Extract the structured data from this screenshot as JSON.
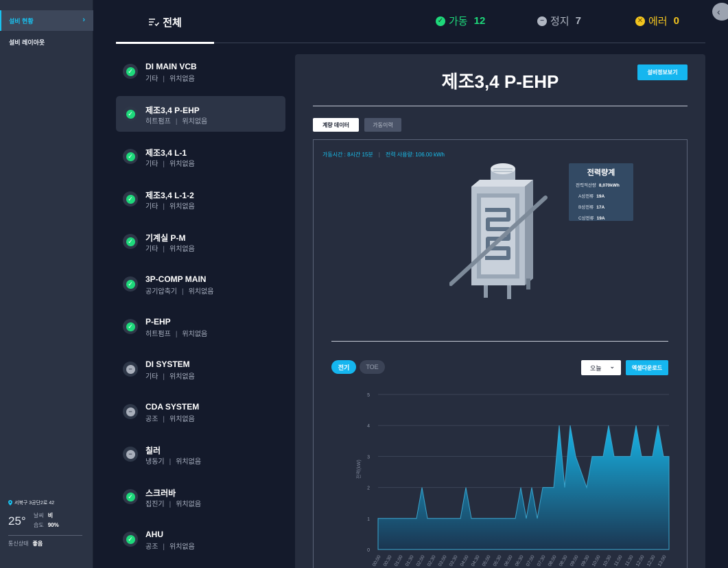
{
  "sidebar": {
    "items": [
      {
        "label": "설비 현황",
        "active": true
      },
      {
        "label": "설비 레이아웃",
        "active": false
      }
    ],
    "weather": {
      "address": "서북구 3공단2로 42",
      "temperature": "25°",
      "weather_label": "날씨",
      "weather_value": "비",
      "humidity_label": "습도",
      "humidity_value": "90%",
      "comm_label": "통신상태",
      "comm_value": "좋음"
    }
  },
  "header": {
    "tab_all": "전체",
    "running_label": "가동",
    "running_count": "12",
    "stopped_label": "정지",
    "stopped_count": "7",
    "error_label": "에러",
    "error_count": "0"
  },
  "equipment": [
    {
      "name": "DI MAIN VCB",
      "type": "기타",
      "location": "위치없음",
      "status": "running"
    },
    {
      "name": "제조3,4 P-EHP",
      "type": "히트펌프",
      "location": "위치없음",
      "status": "running",
      "selected": true
    },
    {
      "name": "제조3,4 L-1",
      "type": "기타",
      "location": "위치없음",
      "status": "running"
    },
    {
      "name": "제조3,4 L-1-2",
      "type": "기타",
      "location": "위치없음",
      "status": "running"
    },
    {
      "name": "기계실 P-M",
      "type": "기타",
      "location": "위치없음",
      "status": "running"
    },
    {
      "name": "3P-COMP MAIN",
      "type": "공기압축기",
      "location": "위치없음",
      "status": "running"
    },
    {
      "name": "P-EHP",
      "type": "히트펌프",
      "location": "위치없음",
      "status": "running"
    },
    {
      "name": "DI SYSTEM",
      "type": "기타",
      "location": "위치없음",
      "status": "stopped"
    },
    {
      "name": "CDA SYSTEM",
      "type": "공조",
      "location": "위치없음",
      "status": "stopped"
    },
    {
      "name": "칠러",
      "type": "냉동기",
      "location": "위치없음",
      "status": "stopped"
    },
    {
      "name": "스크러바",
      "type": "집진기",
      "location": "위치없음",
      "status": "running"
    },
    {
      "name": "AHU",
      "type": "공조",
      "location": "위치없음",
      "status": "running"
    }
  ],
  "detail": {
    "title": "제조3,4 P-EHP",
    "info_button": "설비정보보기",
    "tabs": [
      "계량 데이터",
      "가동이력"
    ],
    "runtime": "가동시간 : 8시간 15분",
    "power_usage": "전력 사용량: 106.00 kWh",
    "meter": {
      "title": "전력량계",
      "rows": [
        {
          "label": "전력적산량",
          "value": "8,070kWh"
        },
        {
          "label": "A상전류",
          "value": "19A"
        },
        {
          "label": "B상전류",
          "value": "17A"
        },
        {
          "label": "C상전류",
          "value": "19A"
        }
      ]
    },
    "chart_tabs": [
      "전기",
      "TOE"
    ],
    "period": "오늘",
    "excel_button": "엑셀다운로드"
  },
  "colors": {
    "accent": "#15b6ef",
    "running": "#1ed97b",
    "stopped": "#b0b6c2",
    "error": "#f3c51f"
  },
  "chart_data": {
    "type": "area",
    "ylabel": "전력(kW)",
    "ylim": [
      0,
      5
    ],
    "yticks": [
      0,
      1,
      2,
      3,
      4,
      5
    ],
    "grid": true,
    "x": [
      "00:00",
      "00:30",
      "01:00",
      "01:30",
      "02:00",
      "02:30",
      "03:00",
      "03:30",
      "04:00",
      "04:30",
      "05:00",
      "05:30",
      "06:00",
      "06:30",
      "07:00",
      "07:30",
      "08:00",
      "08:30",
      "09:00",
      "09:30",
      "10:00",
      "10:30",
      "11:00",
      "11:30",
      "12:00",
      "12:30",
      "13:00"
    ],
    "points": [
      [
        "00:00",
        1
      ],
      [
        "00:30",
        1
      ],
      [
        "01:00",
        1
      ],
      [
        "01:30",
        1
      ],
      [
        "01:45",
        1
      ],
      [
        "02:00",
        2
      ],
      [
        "02:15",
        1
      ],
      [
        "02:30",
        1
      ],
      [
        "03:00",
        1
      ],
      [
        "03:30",
        1
      ],
      [
        "03:45",
        1
      ],
      [
        "04:00",
        2
      ],
      [
        "04:15",
        1
      ],
      [
        "04:30",
        1
      ],
      [
        "05:00",
        1
      ],
      [
        "05:30",
        1
      ],
      [
        "06:00",
        1
      ],
      [
        "06:15",
        1
      ],
      [
        "06:30",
        2
      ],
      [
        "06:45",
        1
      ],
      [
        "07:00",
        2
      ],
      [
        "07:15",
        1
      ],
      [
        "07:30",
        2
      ],
      [
        "08:00",
        2
      ],
      [
        "08:15",
        4
      ],
      [
        "08:30",
        2
      ],
      [
        "08:45",
        4
      ],
      [
        "09:00",
        3
      ],
      [
        "09:30",
        2
      ],
      [
        "09:45",
        3
      ],
      [
        "10:00",
        3
      ],
      [
        "10:15",
        3
      ],
      [
        "10:30",
        4
      ],
      [
        "10:45",
        3
      ],
      [
        "11:00",
        3
      ],
      [
        "11:30",
        3
      ],
      [
        "11:45",
        4
      ],
      [
        "12:00",
        3
      ],
      [
        "12:30",
        3
      ],
      [
        "12:45",
        4
      ],
      [
        "13:00",
        3
      ],
      [
        "13:15",
        3
      ]
    ]
  }
}
